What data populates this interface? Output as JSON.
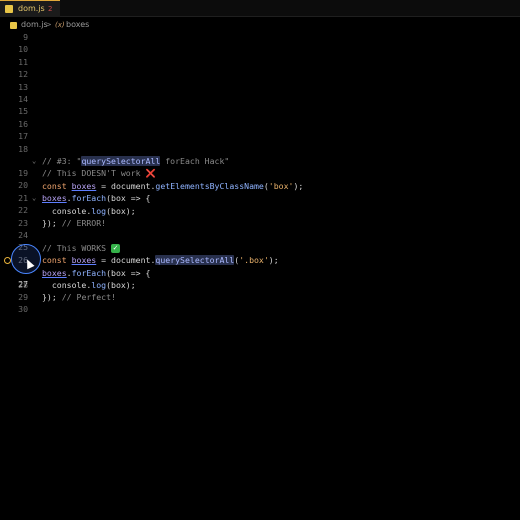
{
  "tab": {
    "name": "dom.js",
    "badge": "2"
  },
  "breadcrumb": {
    "file": "dom.js",
    "separator": ">",
    "var_icon": "(x)",
    "symbol": "boxes"
  },
  "lines": [
    {
      "n": "9"
    },
    {
      "n": "10"
    },
    {
      "n": "11"
    },
    {
      "n": "12"
    },
    {
      "n": "13"
    },
    {
      "n": "14"
    },
    {
      "n": "15"
    },
    {
      "n": "16"
    },
    {
      "n": "17"
    },
    {
      "n": "18"
    },
    {
      "n": "19",
      "t": [
        "// #3: \"",
        "querySelectorAll",
        " forEach Hack\""
      ]
    },
    {
      "n": "20",
      "t": [
        "// This DOESN'T work "
      ],
      "icon": "❌"
    },
    {
      "n": "21",
      "t": [
        "const",
        " ",
        "boxes",
        " = document.",
        "getElementsByClassName",
        "(",
        "'box'",
        ");"
      ]
    },
    {
      "n": "22",
      "t": [
        "boxes",
        ".",
        "forEach",
        "(box => {"
      ]
    },
    {
      "n": "23",
      "t": [
        "  console.",
        "log",
        "(box);"
      ]
    },
    {
      "n": "24",
      "t": [
        "});",
        " // ERROR!"
      ]
    },
    {
      "n": "25"
    },
    {
      "n": "26",
      "t": [
        "// This WORKS "
      ],
      "icon": "✓"
    },
    {
      "n": "27",
      "t": [
        "const",
        " ",
        "boxes",
        " = document.",
        "querySelectorAll",
        "(",
        "'.box'",
        ");"
      ]
    },
    {
      "n": "28",
      "t": [
        "boxes",
        ".",
        "forEach",
        "(box => {"
      ]
    },
    {
      "n": "29",
      "t": [
        "  console.",
        "log",
        "(box);"
      ]
    },
    {
      "n": "30",
      "t": [
        "});",
        " // Perfect!"
      ]
    }
  ],
  "colors": {
    "accent": "#4a86ff",
    "tab_border": "#e0a93a",
    "error": "#ff3b3b",
    "ok": "#35b24a"
  }
}
